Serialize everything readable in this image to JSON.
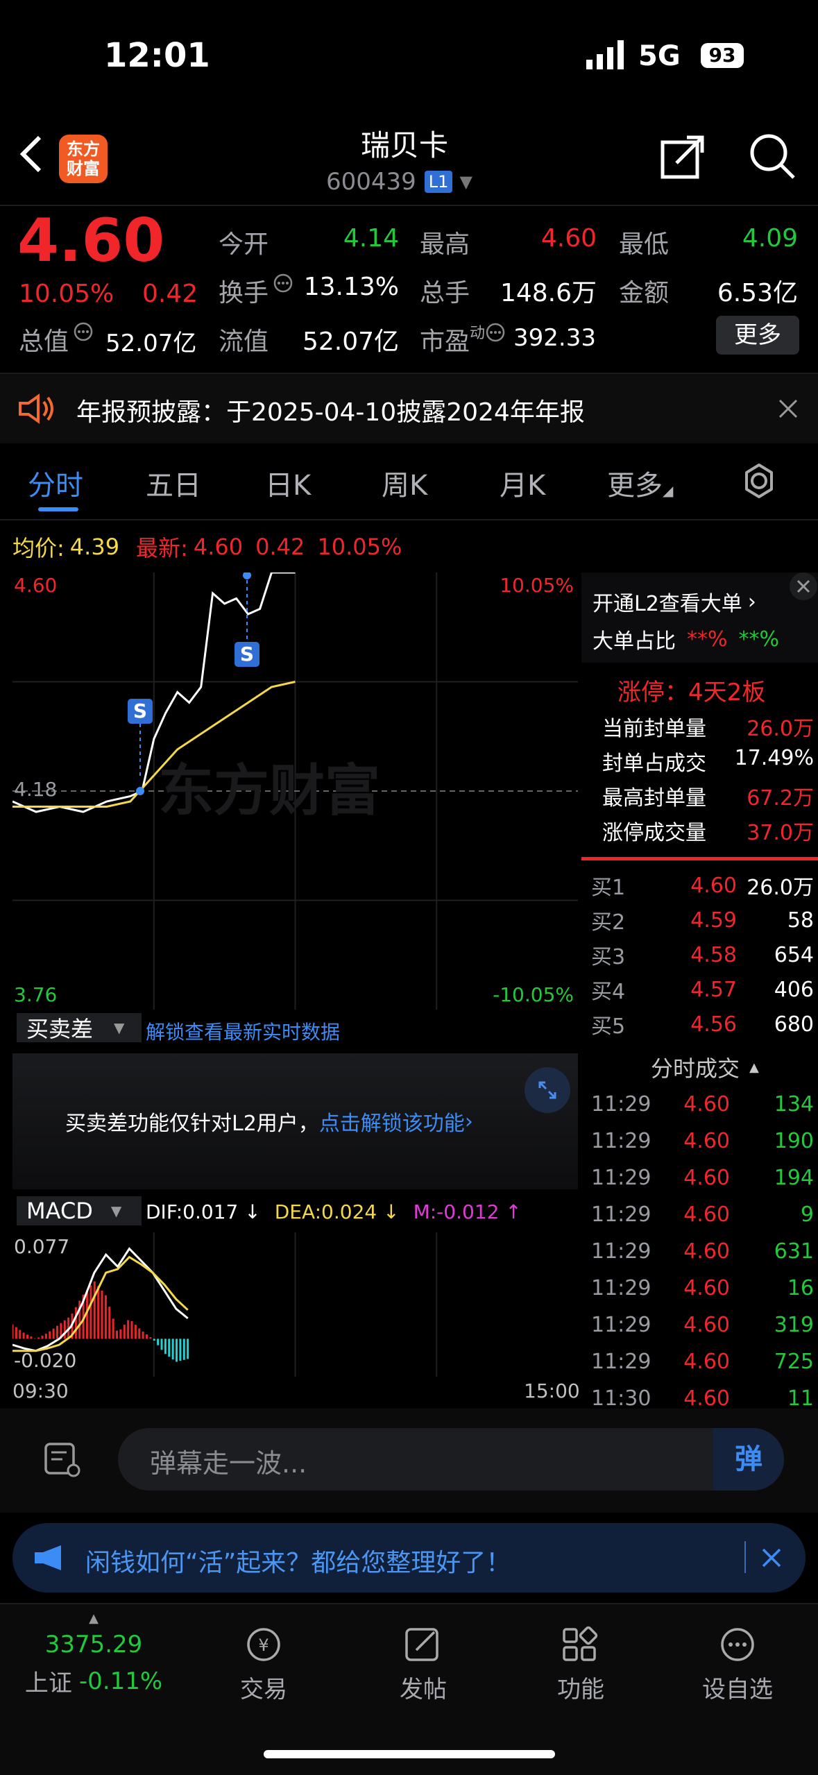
{
  "status_bar": {
    "time": "12:01",
    "network": "5G",
    "battery": "93"
  },
  "header": {
    "title": "瑞贝卡",
    "code": "600439",
    "level_badge": "L1",
    "logo_line1": "东方",
    "logo_line2": "财富"
  },
  "quote": {
    "price": "4.60",
    "change_pct": "10.05%",
    "change": "0.42",
    "open_label": "今开",
    "open": "4.14",
    "high_label": "最高",
    "high": "4.60",
    "low_label": "最低",
    "low": "4.09",
    "turnover_label": "换手",
    "turnover": "13.13%",
    "volume_label": "总手",
    "volume": "148.6万",
    "amount_label": "金额",
    "amount": "6.53亿",
    "mktcap_label": "总值",
    "mktcap": "52.07亿",
    "float_label": "流值",
    "float": "52.07亿",
    "pe_label": "市盈",
    "pe_sup": "动",
    "pe": "392.33",
    "more_button": "更多"
  },
  "notice": {
    "text": "年报预披露：于2025-04-10披露2024年年报"
  },
  "tabs": [
    {
      "label": "分时",
      "active": true
    },
    {
      "label": "五日"
    },
    {
      "label": "日K"
    },
    {
      "label": "周K"
    },
    {
      "label": "月K"
    },
    {
      "label": "更多"
    }
  ],
  "chart_info": {
    "avg_label": "均价:",
    "avg": "4.39",
    "latest_label": "最新:",
    "latest": "4.60",
    "chg": "0.42",
    "chg_pct": "10.05%"
  },
  "chart_labels": {
    "top_price": "4.60",
    "top_pct": "10.05%",
    "mid_price": "4.18",
    "bottom_price": "3.76",
    "bottom_pct": "-10.05%",
    "watermark": "东方财富",
    "marker": "S",
    "time_start": "09:30",
    "time_end": "15:00"
  },
  "chart_data": [
    {
      "type": "line",
      "title": "",
      "x_range": [
        "09:30",
        "15:00"
      ],
      "ylim": [
        3.76,
        4.6
      ],
      "series": [
        {
          "name": "",
          "x": [
            "09:30",
            "09:40",
            "09:50",
            "10:00",
            "10:10",
            "10:20",
            "10:25",
            "10:30",
            "10:35",
            "10:40",
            "10:45",
            "10:50",
            "10:55",
            "11:00",
            "11:05",
            "11:10",
            "11:15",
            "11:20",
            "11:25",
            "11:30"
          ],
          "values": [
            4.16,
            4.14,
            4.15,
            4.14,
            4.16,
            4.17,
            4.18,
            4.28,
            4.33,
            4.37,
            4.35,
            4.38,
            4.56,
            4.54,
            4.55,
            4.52,
            4.53,
            4.6,
            4.6,
            4.6
          ]
        },
        {
          "name": "",
          "x": [
            "09:30",
            "09:40",
            "09:50",
            "10:00",
            "10:10",
            "10:20",
            "10:30",
            "10:40",
            "10:50",
            "11:00",
            "11:10",
            "11:20",
            "11:30"
          ],
          "values": [
            4.15,
            4.15,
            4.15,
            4.15,
            4.15,
            4.16,
            4.21,
            4.26,
            4.29,
            4.32,
            4.35,
            4.38,
            4.39
          ]
        }
      ]
    },
    {
      "type": "line",
      "title": "MACD",
      "ylim": [
        -0.02,
        0.077
      ],
      "series": [
        {
          "name": "DIF",
          "values": [
            -0.005,
            -0.008,
            -0.01,
            -0.006,
            0.0,
            0.01,
            0.03,
            0.055,
            0.07,
            0.06,
            0.075,
            0.065,
            0.055,
            0.04,
            0.025,
            0.017
          ]
        },
        {
          "name": "DEA",
          "values": [
            -0.01,
            -0.01,
            -0.01,
            -0.008,
            -0.005,
            0.002,
            0.015,
            0.035,
            0.055,
            0.058,
            0.068,
            0.062,
            0.055,
            0.045,
            0.033,
            0.024
          ]
        }
      ]
    }
  ],
  "indicators": {
    "bs_label": "买卖差",
    "bs_unlock": "解锁查看最新实时数据",
    "bs_msg": "买卖差功能仅针对L2用户，",
    "bs_link": "点击解锁该功能",
    "macd_label": "MACD",
    "dif": "DIF:0.017 ↓",
    "dea": "DEA:0.024 ↓",
    "m": "M:-0.012 ↑",
    "macd_top": "0.077",
    "macd_bottom": "-0.020"
  },
  "sidepanel": {
    "l2_link": "开通L2查看大单",
    "big_order_label": "大单占比",
    "big_order_red": "**%",
    "big_order_green": "**%",
    "limit_title": "涨停：4天2板",
    "seal_label": "当前封单量",
    "seal": "26.0万",
    "seal_ratio_label": "封单占成交",
    "seal_ratio": "17.49%",
    "max_seal_label": "最高封单量",
    "max_seal": "67.2万",
    "limit_vol_label": "涨停成交量",
    "limit_vol": "37.0万",
    "bids": [
      {
        "label": "买1",
        "price": "4.60",
        "vol": "26.0万"
      },
      {
        "label": "买2",
        "price": "4.59",
        "vol": "58"
      },
      {
        "label": "买3",
        "price": "4.58",
        "vol": "654"
      },
      {
        "label": "买4",
        "price": "4.57",
        "vol": "406"
      },
      {
        "label": "买5",
        "price": "4.56",
        "vol": "680"
      }
    ],
    "ticks_title": "分时成交",
    "ticks": [
      {
        "time": "11:29",
        "price": "4.60",
        "vol": "134"
      },
      {
        "time": "11:29",
        "price": "4.60",
        "vol": "190"
      },
      {
        "time": "11:29",
        "price": "4.60",
        "vol": "194"
      },
      {
        "time": "11:29",
        "price": "4.60",
        "vol": "9"
      },
      {
        "time": "11:29",
        "price": "4.60",
        "vol": "631"
      },
      {
        "time": "11:29",
        "price": "4.60",
        "vol": "16"
      },
      {
        "time": "11:29",
        "price": "4.60",
        "vol": "319"
      },
      {
        "time": "11:29",
        "price": "4.60",
        "vol": "725"
      },
      {
        "time": "11:30",
        "price": "4.60",
        "vol": "11"
      }
    ]
  },
  "comment": {
    "placeholder": "弹幕走一波...",
    "send": "弹"
  },
  "banner": {
    "text": "闲钱如何“活”起来？都给您整理好了！"
  },
  "bottom_nav": {
    "index_value": "3375.29",
    "index_name": "上证",
    "index_change": "-0.11%",
    "items": [
      "交易",
      "发帖",
      "功能",
      "设自选"
    ]
  }
}
